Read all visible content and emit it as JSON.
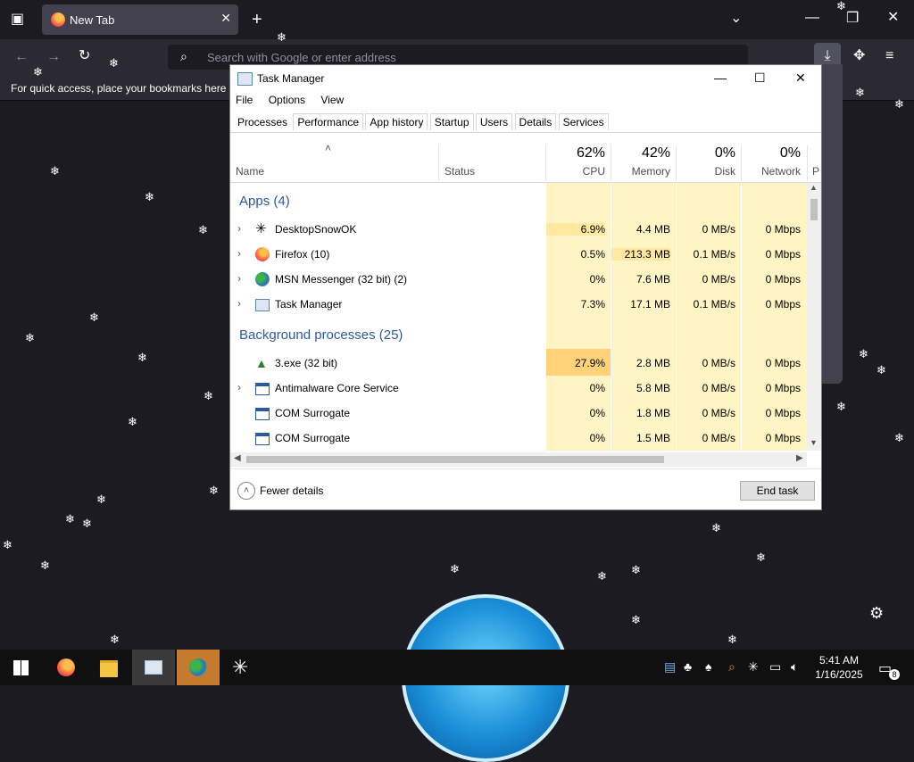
{
  "browser": {
    "tab_title": "New Tab",
    "url_placeholder": "Search with Google or enter address",
    "bookmarks_hint": "For quick access, place your bookmarks here o"
  },
  "taskmanager": {
    "title": "Task Manager",
    "menu": [
      "File",
      "Options",
      "View"
    ],
    "tabs": [
      "Processes",
      "Performance",
      "App history",
      "Startup",
      "Users",
      "Details",
      "Services"
    ],
    "columns": {
      "name": "Name",
      "status": "Status",
      "cpu_pct": "62%",
      "cpu": "CPU",
      "mem_pct": "42%",
      "mem": "Memory",
      "disk_pct": "0%",
      "disk": "Disk",
      "net_pct": "0%",
      "net": "Network",
      "power": "P"
    },
    "apps_group": "Apps (4)",
    "bg_group": "Background processes (25)",
    "apps": [
      {
        "name": "DesktopSnowOK",
        "cpu": "6.9%",
        "mem": "4.4 MB",
        "disk": "0 MB/s",
        "net": "0 Mbps"
      },
      {
        "name": "Firefox (10)",
        "cpu": "0.5%",
        "mem": "213.3 MB",
        "disk": "0.1 MB/s",
        "net": "0 Mbps"
      },
      {
        "name": "MSN Messenger (32 bit) (2)",
        "cpu": "0%",
        "mem": "7.6 MB",
        "disk": "0 MB/s",
        "net": "0 Mbps"
      },
      {
        "name": "Task Manager",
        "cpu": "7.3%",
        "mem": "17.1 MB",
        "disk": "0.1 MB/s",
        "net": "0 Mbps"
      }
    ],
    "background": [
      {
        "name": "3.exe (32 bit)",
        "cpu": "27.9%",
        "mem": "2.8 MB",
        "disk": "0 MB/s",
        "net": "0 Mbps"
      },
      {
        "name": "Antimalware Core Service",
        "cpu": "0%",
        "mem": "5.8 MB",
        "disk": "0 MB/s",
        "net": "0 Mbps"
      },
      {
        "name": "COM Surrogate",
        "cpu": "0%",
        "mem": "1.8 MB",
        "disk": "0 MB/s",
        "net": "0 Mbps"
      },
      {
        "name": "COM Surrogate",
        "cpu": "0%",
        "mem": "1.5 MB",
        "disk": "0 MB/s",
        "net": "0 Mbps"
      }
    ],
    "fewer_details": "Fewer details",
    "end_task": "End task"
  },
  "taskbar": {
    "time": "5:41 AM",
    "date": "1/16/2025",
    "notifications": "8"
  },
  "colors": {
    "cpu_heat_light": "#fff4c4",
    "cpu_heat_mid": "#ffe8a0",
    "cpu_heat_high": "#ffd27a",
    "group_blue": "#2c5aa0"
  }
}
